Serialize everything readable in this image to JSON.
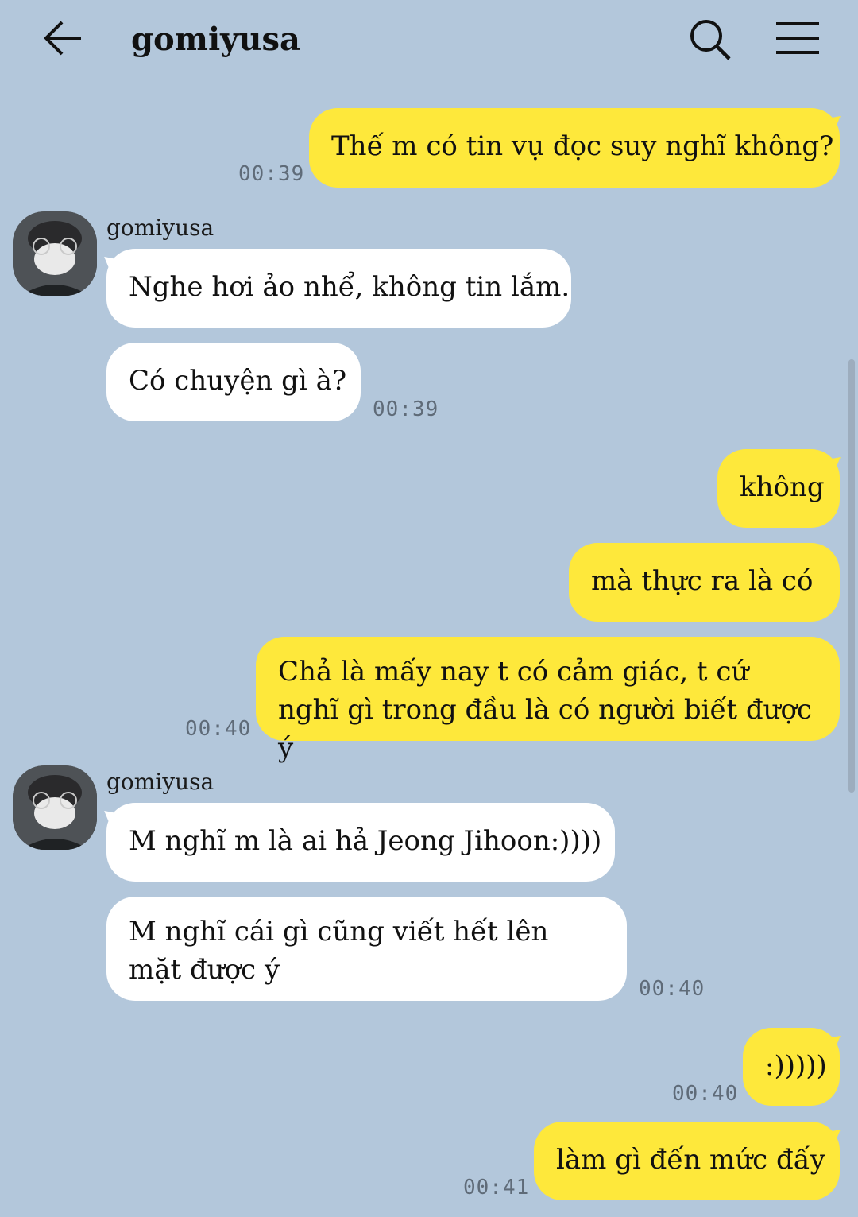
{
  "header": {
    "title": "gomiyusa"
  },
  "messages": [
    {
      "text": "Thế m có tin vụ đọc suy nghĩ không?",
      "time": "00:39"
    },
    {
      "sender": "gomiyusa",
      "text": "Nghe hơi ảo nhể, không tin lắm."
    },
    {
      "text": "Có chuyện gì à?",
      "time": "00:39"
    },
    {
      "text": "không"
    },
    {
      "text": "mà thực ra là có"
    },
    {
      "text": "Chả là mấy nay t có cảm giác, t cứ nghĩ gì trong đầu là có người biết được ý",
      "time": "00:40"
    },
    {
      "sender": "gomiyusa",
      "text": "M nghĩ m là ai hả Jeong Jihoon:))))"
    },
    {
      "text": "M nghĩ cái gì cũng viết hết lên mặt được ý",
      "time": "00:40"
    },
    {
      "text": ":)))))",
      "time": "00:40"
    },
    {
      "text": "làm gì đến mức đấy",
      "time": "00:41"
    }
  ]
}
